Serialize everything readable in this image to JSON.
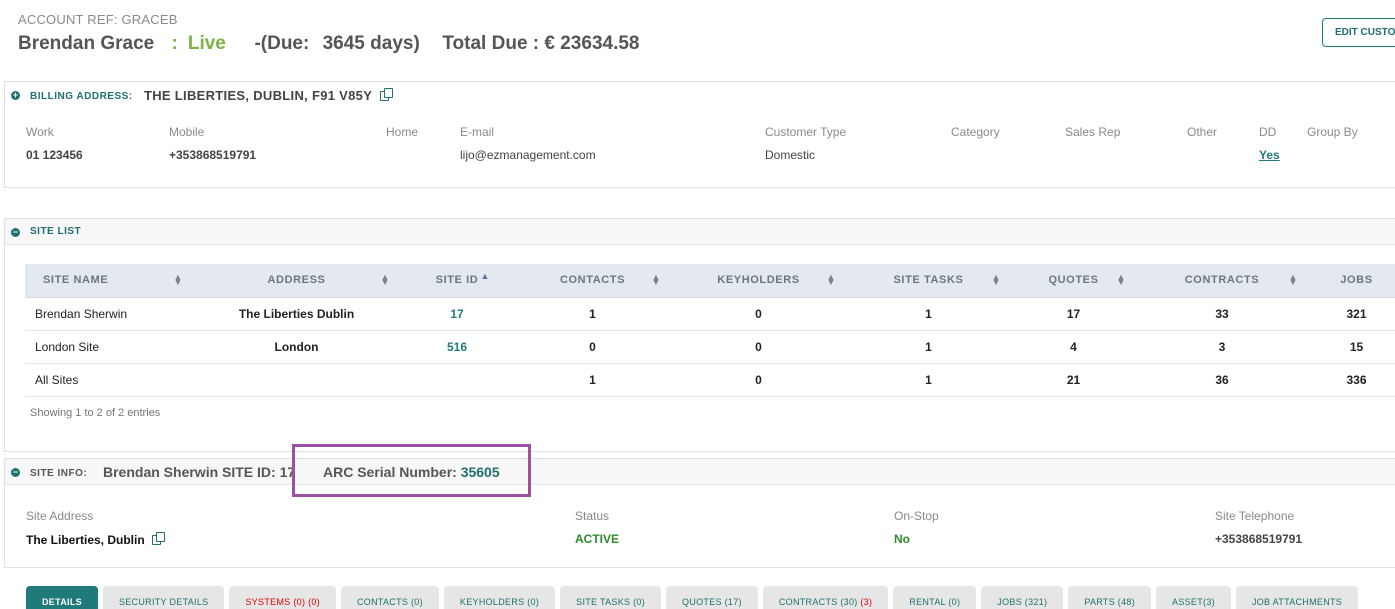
{
  "header": {
    "account_ref": "ACCOUNT REF: GRACEB",
    "customer_name": "Brendan Grace",
    "status_sep": ":",
    "status": "Live",
    "due_open": "-(Due:",
    "due_days": "3645 days)",
    "total_due": "Total Due : € 23634.58",
    "edit_button": "EDIT CUSTOMER"
  },
  "billing": {
    "label": "BILLING ADDRESS:",
    "address": "THE LIBERTIES, DUBLIN, F91 V85Y",
    "fields": {
      "work": {
        "label": "Work",
        "value": "01 123456"
      },
      "mobile": {
        "label": "Mobile",
        "value": "+353868519791"
      },
      "home": {
        "label": "Home",
        "value": ""
      },
      "email": {
        "label": "E-mail",
        "value": "lijo@ezmanagement.com"
      },
      "customer_type": {
        "label": "Customer Type",
        "value": "Domestic"
      },
      "category": {
        "label": "Category",
        "value": ""
      },
      "sales_rep": {
        "label": "Sales Rep",
        "value": ""
      },
      "other": {
        "label": "Other",
        "value": ""
      },
      "dd": {
        "label": "DD",
        "value": "Yes"
      },
      "group_by": {
        "label": "Group By",
        "value": ""
      }
    }
  },
  "site_list": {
    "label": "SITE LIST",
    "columns": [
      "SITE NAME",
      "ADDRESS",
      "SITE ID",
      "CONTACTS",
      "KEYHOLDERS",
      "SITE TASKS",
      "QUOTES",
      "CONTRACTS",
      "JOBS"
    ],
    "rows": [
      {
        "name": "Brendan Sherwin",
        "address": "The Liberties Dublin",
        "site_id": "17",
        "contacts": "1",
        "keyholders": "0",
        "site_tasks": "1",
        "quotes": "17",
        "contracts": "33",
        "jobs": "321"
      },
      {
        "name": "London Site",
        "address": "London",
        "site_id": "516",
        "contacts": "0",
        "keyholders": "0",
        "site_tasks": "1",
        "quotes": "4",
        "contracts": "3",
        "jobs": "15"
      },
      {
        "name": "All Sites",
        "address": "",
        "site_id": "",
        "contacts": "1",
        "keyholders": "0",
        "site_tasks": "1",
        "quotes": "21",
        "contracts": "36",
        "jobs": "336"
      }
    ],
    "showing": "Showing 1 to 2 of 2 entries"
  },
  "site_info": {
    "label": "SITE INFO:",
    "title": "Brendan Sherwin SITE ID: 17",
    "arc_label": "ARC Serial Number:",
    "arc_number": "35605",
    "fields": {
      "site_address": {
        "label": "Site Address",
        "value": "The Liberties, Dublin"
      },
      "status": {
        "label": "Status",
        "value": "ACTIVE"
      },
      "on_stop": {
        "label": "On-Stop",
        "value": "No"
      },
      "site_telephone": {
        "label": "Site Telephone",
        "value": "+353868519791"
      }
    }
  },
  "tabs": [
    {
      "label": "DETAILS",
      "badge": ""
    },
    {
      "label": "SECURITY DETAILS",
      "badge": ""
    },
    {
      "label": "SYSTEMS (0)",
      "badge": "(0)"
    },
    {
      "label": "CONTACTS (0)",
      "badge": ""
    },
    {
      "label": "KEYHOLDERS (0)",
      "badge": ""
    },
    {
      "label": "SITE TASKS (0)",
      "badge": ""
    },
    {
      "label": "QUOTES (17)",
      "badge": ""
    },
    {
      "label": "CONTRACTS (30)",
      "badge": "(3)"
    },
    {
      "label": "RENTAL (0)",
      "badge": ""
    },
    {
      "label": "JOBS (321)",
      "badge": ""
    },
    {
      "label": "PARTS (48)",
      "badge": ""
    },
    {
      "label": "ASSET(3)",
      "badge": ""
    },
    {
      "label": "JOB ATTACHMENTS",
      "badge": ""
    }
  ],
  "colors": {
    "accent": "#1f6f6f",
    "live": "#7cb342",
    "highlight": "#9c4fa5",
    "warning": "#dd0000"
  }
}
